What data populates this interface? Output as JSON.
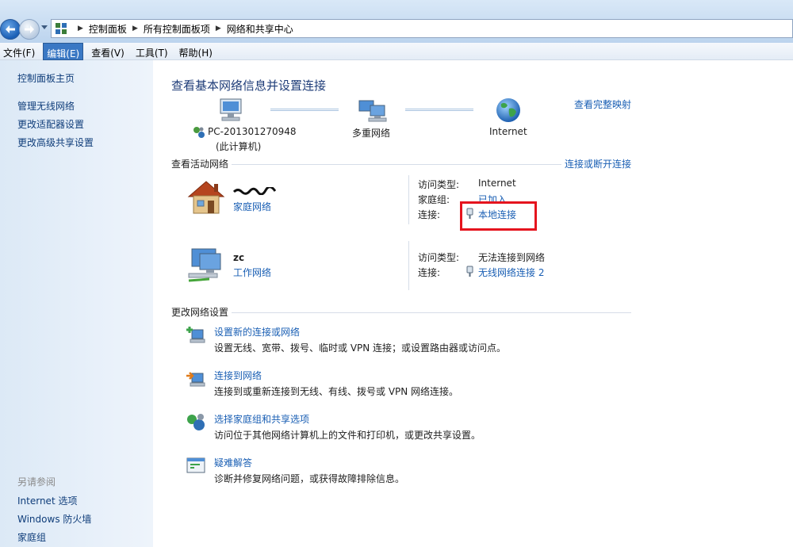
{
  "breadcrumb": {
    "items": [
      "控制面板",
      "所有控制面板项",
      "网络和共享中心"
    ],
    "separator": "▶"
  },
  "menu": {
    "items": [
      "文件(F)",
      "编辑(E)",
      "查看(V)",
      "工具(T)",
      "帮助(H)"
    ],
    "active_index": 1
  },
  "sidebar": {
    "home": "控制面板主页",
    "links": [
      "管理无线网络",
      "更改适配器设置",
      "更改高级共享设置"
    ],
    "see_also_title": "另请参阅",
    "see_also": [
      "Internet 选项",
      "Windows 防火墙",
      "家庭组"
    ]
  },
  "main": {
    "title": "查看基本网络信息并设置连接",
    "full_map_link": "查看完整映射",
    "map": {
      "computer_name": "PC-201301270948",
      "computer_sub": "(此计算机)",
      "multi_network": "多重网络",
      "internet": "Internet"
    },
    "active_section_label": "查看活动网络",
    "connect_disconnect_link": "连接或断开连接",
    "networks": [
      {
        "name": "",
        "type": "家庭网络",
        "access_type_label": "访问类型:",
        "access_type": "Internet",
        "homegroup_label": "家庭组:",
        "homegroup": "已加入",
        "connection_label": "连接:",
        "connection": "本地连接"
      },
      {
        "name": "zc",
        "type": "工作网络",
        "access_type_label": "访问类型:",
        "access_type": "无法连接到网络",
        "connection_label": "连接:",
        "connection": "无线网络连接 2"
      }
    ],
    "change_section_label": "更改网络设置",
    "tasks": [
      {
        "title": "设置新的连接或网络",
        "desc": "设置无线、宽带、拨号、临时或 VPN 连接；或设置路由器或访问点。",
        "icon": "new-connection-icon"
      },
      {
        "title": "连接到网络",
        "desc": "连接到或重新连接到无线、有线、拨号或 VPN 网络连接。",
        "icon": "connect-network-icon"
      },
      {
        "title": "选择家庭组和共享选项",
        "desc": "访问位于其他网络计算机上的文件和打印机，或更改共享设置。",
        "icon": "homegroup-icon"
      },
      {
        "title": "疑难解答",
        "desc": "诊断并修复网络问题，或获得故障排除信息。",
        "icon": "troubleshoot-icon"
      }
    ]
  },
  "colors": {
    "link": "#1a5fb4",
    "title": "#1e3c78",
    "sidebar_link": "#0f3d7a",
    "highlight_box": "#e5141e",
    "menu_active": "#3a78c4"
  }
}
